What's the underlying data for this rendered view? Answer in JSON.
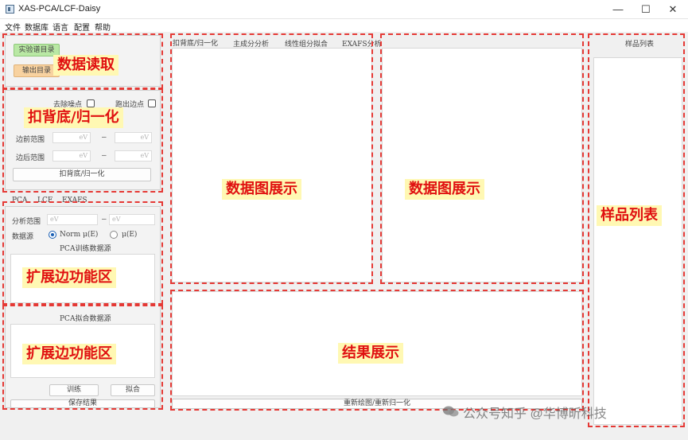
{
  "window": {
    "title": "XAS-PCA/LCF-Daisy",
    "minimize": "—",
    "maximize": "☐",
    "close": "✕"
  },
  "menu": [
    "文件",
    "数据库",
    "语言",
    "配置",
    "帮助"
  ],
  "data_read": {
    "btn_spectra": "实验谱目录",
    "btn_output": "输出目录"
  },
  "background": {
    "opt_a": "去除噪点",
    "opt_b": "跑出边点",
    "pre_label": "边前范围",
    "post_label": "边后范围",
    "unit_placeholder": "eV",
    "dash": "–",
    "button": "扣背底/归一化"
  },
  "analysis_tabs": [
    "PCA",
    "LCF",
    "EXAFS"
  ],
  "pca": {
    "range_label": "分析范围",
    "unit_placeholder": "eV",
    "source_label": "数据源",
    "source_options": [
      "Norm μ(E)",
      "μ(E)"
    ],
    "train_source": "PCA训练数据源",
    "fit_source": "PCA拟合数据源",
    "train_btn": "训练",
    "fit_btn": "拟合",
    "save_btn": "保存结果"
  },
  "plot_tabs": [
    "扣背底/归一化",
    "主成分分析",
    "线性组分拟合",
    "EXAFS分析"
  ],
  "results": {
    "button": "重新绘图/重新归一化"
  },
  "samples": {
    "header": "样品列表"
  },
  "annotations": {
    "data_read": "数据读取",
    "background": "扣背底/归一化",
    "ext1": "扩展边功能区",
    "ext2": "扩展边功能区",
    "plot1": "数据图展示",
    "plot2": "数据图展示",
    "results": "结果展示",
    "samples": "样品列表"
  },
  "watermark": "公众号知乎 @华博昕科技",
  "colors": {
    "annotation_text": "#e01010",
    "annotation_bg": "#fff8b3",
    "dashed_border": "#e53935",
    "btn_green": "#b9e8a4",
    "btn_orange": "#f8d2a0",
    "radio_accent": "#1a5fb4"
  }
}
